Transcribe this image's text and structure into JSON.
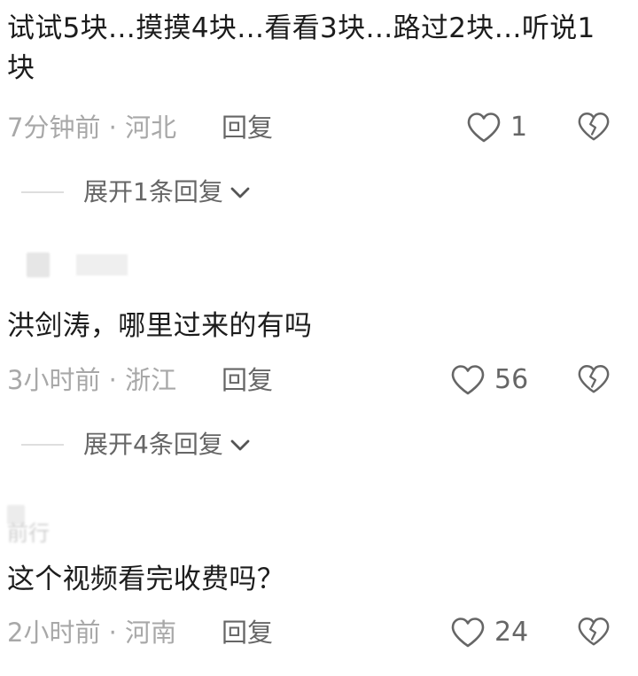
{
  "comments": [
    {
      "text": "试试5块…摸摸4块…看看3块…路过2块…听说1块",
      "time_location": "7分钟前 · 河北",
      "reply_label": "回复",
      "like_count": "1",
      "expand_label": "展开1条回复"
    },
    {
      "text": "洪剑涛，哪里过来的有吗",
      "time_location": "3小时前 · 浙江",
      "reply_label": "回复",
      "like_count": "56",
      "expand_label": "展开4条回复"
    },
    {
      "author_partial": "前行",
      "text": "这个视频看完收费吗？",
      "time_location": "2小时前 · 河南",
      "reply_label": "回复",
      "like_count": "24"
    }
  ],
  "icons": {
    "like": "heart-outline-icon",
    "dislike": "broken-heart-icon",
    "expand": "chevron-down-icon"
  },
  "colors": {
    "text": "#1c1c1c",
    "meta": "#a8a8a8",
    "action": "#666666"
  }
}
